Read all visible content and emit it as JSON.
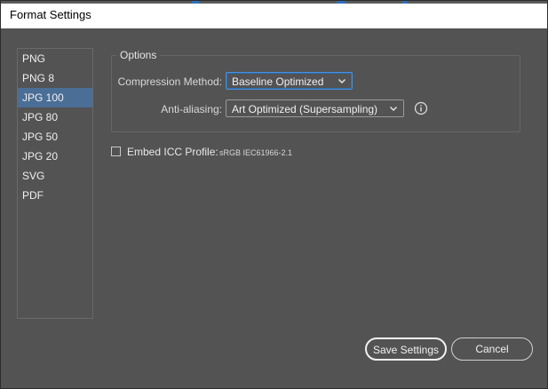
{
  "window": {
    "title": "Format Settings"
  },
  "formats": {
    "items": [
      "PNG",
      "PNG 8",
      "JPG 100",
      "JPG 80",
      "JPG 50",
      "JPG 20",
      "SVG",
      "PDF"
    ],
    "selected": "JPG 100"
  },
  "options": {
    "legend": "Options",
    "compression": {
      "label": "Compression Method:",
      "value": "Baseline Optimized"
    },
    "antialiasing": {
      "label": "Anti-aliasing:",
      "value": "Art Optimized (Supersampling)"
    }
  },
  "icc": {
    "checked": false,
    "label": "Embed ICC Profile:",
    "profile": "sRGB IEC61966-2.1"
  },
  "buttons": {
    "save": "Save Settings",
    "cancel": "Cancel"
  },
  "colors": {
    "background": "#535353",
    "selection": "#4b6e96",
    "focus": "#4a90d9"
  },
  "icons": {
    "dropdown": "chevron-down-icon",
    "info": "info-icon"
  }
}
